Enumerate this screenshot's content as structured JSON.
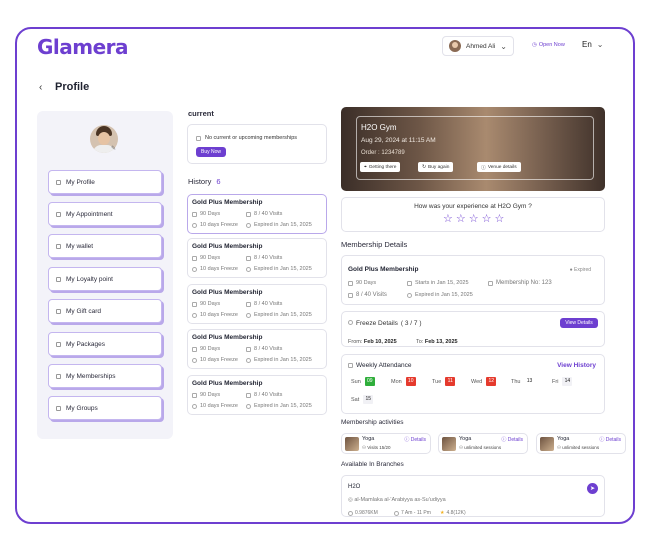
{
  "header": {
    "logo": "Glamera",
    "user_name": "Ahmed Ali",
    "open_now": "Open Now",
    "language": "En"
  },
  "page": {
    "title": "Profile"
  },
  "sidebar": {
    "items": [
      {
        "label": "My Profile"
      },
      {
        "label": "My Appointment"
      },
      {
        "label": "My wallet"
      },
      {
        "label": "My Loyalty point"
      },
      {
        "label": "My Gift card"
      },
      {
        "label": "My Packages"
      },
      {
        "label": "My Memberships"
      },
      {
        "label": "My Groups"
      }
    ]
  },
  "current": {
    "heading": "current",
    "empty_text": "No current or upcoming memberships",
    "buy_button": "Buy Now"
  },
  "history": {
    "heading": "History",
    "count": "6",
    "items": [
      {
        "title": "Gold Plus Membership",
        "days": "90 Days",
        "visits": "8 / 40 Visits",
        "freeze": "10 days Freeze",
        "expired": "Expired in Jan 15, 2025"
      },
      {
        "title": "Gold Plus Membership",
        "days": "90 Days",
        "visits": "8 / 40 Visits",
        "freeze": "10 days Freeze",
        "expired": "Expired in Jan 15, 2025"
      },
      {
        "title": "Gold Plus Membership",
        "days": "90 Days",
        "visits": "8 / 40 Visits",
        "freeze": "10 days Freeze",
        "expired": "Expired in Jan 15, 2025"
      },
      {
        "title": "Gold Plus Membership",
        "days": "90 Days",
        "visits": "8 / 40 Visits",
        "freeze": "10 days Freeze",
        "expired": "Expired in Jan 15, 2025"
      },
      {
        "title": "Gold Plus Membership",
        "days": "90 Days",
        "visits": "8 / 40 Visits",
        "freeze": "10 days Freeze",
        "expired": "Expired in Jan 15, 2025"
      }
    ]
  },
  "gym": {
    "name": "H2O Gym",
    "date": "Aug 29, 2024 at 11:15 AM",
    "order": "Order : 1234789",
    "getting_there": "Getting there",
    "buy_again": "Buy again",
    "venue_details": "Venue details"
  },
  "rating": {
    "question": "How was your experience at H2O Gym ?",
    "stars": 5
  },
  "details": {
    "heading": "Membership Details",
    "name": "Gold Plus Membership",
    "status": "Expired",
    "days": "90 Days",
    "starts": "Starts in Jan 15, 2025",
    "number": "Membership No: 123",
    "visits": "8 / 40 Visits",
    "expired": "Expired in Jan 15, 2025"
  },
  "freeze": {
    "title": "Freeze Details",
    "count": "( 3 / 7 )",
    "view_details": "View Details",
    "from_label": "From:",
    "from": "Feb 10, 2025",
    "to_label": "To:",
    "to": "Feb 13, 2025"
  },
  "attendance": {
    "title": "Weekly Attendance",
    "view_history": "View History",
    "days": [
      {
        "day": "Sun",
        "num": "09",
        "state": "g"
      },
      {
        "day": "Mon",
        "num": "10",
        "state": "r"
      },
      {
        "day": "Tue",
        "num": "11",
        "state": "r"
      },
      {
        "day": "Wed",
        "num": "12",
        "state": "r"
      },
      {
        "day": "Thu",
        "num": "13",
        "state": "n"
      },
      {
        "day": "Fri",
        "num": "14",
        "state": "n"
      },
      {
        "day": "Sat",
        "num": "15",
        "state": "n"
      }
    ]
  },
  "activities": {
    "heading": "Membership activities",
    "items": [
      {
        "name": "Yoga",
        "details": "Details",
        "sub": "Visits 15/20"
      },
      {
        "name": "Yoga",
        "details": "Details",
        "sub": "unlimited sessions"
      },
      {
        "name": "Yoga",
        "details": "Details",
        "sub": "unlimited sessions"
      }
    ]
  },
  "branches": {
    "heading": "Available In Branches",
    "name": "H2O",
    "address": "al-Mamlaka al-'Arabiyya as-Su'udiyya",
    "distance": "0.9876KM",
    "hours": "7 Am - 11 Pm",
    "rating": "4.8(12K)"
  },
  "colors": {
    "brand": "#6d3fd0",
    "present": "#2fae3b",
    "absent": "#e53a2d"
  }
}
